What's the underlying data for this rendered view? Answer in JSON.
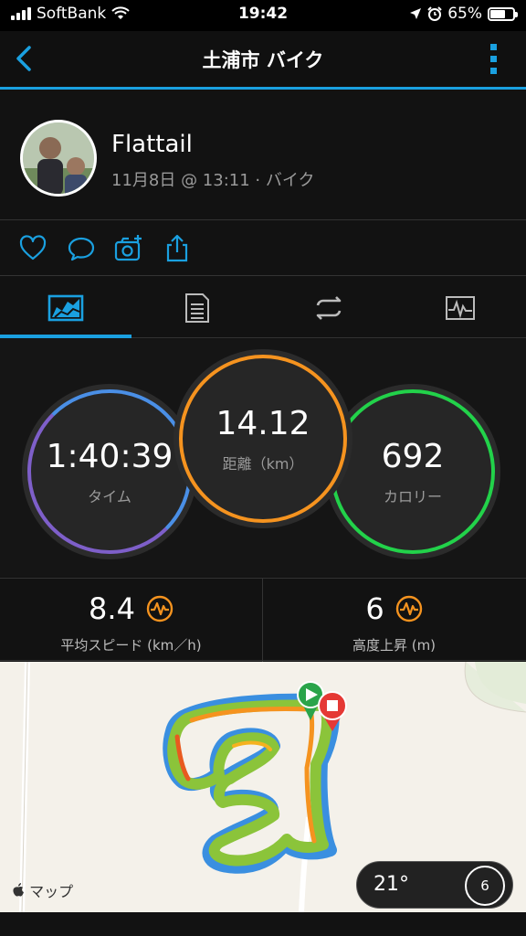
{
  "status_bar": {
    "carrier": "SoftBank",
    "time": "19:42",
    "battery": "65%",
    "battery_level": 0.65
  },
  "header": {
    "title": "土浦市 バイク"
  },
  "profile": {
    "name": "Flattail",
    "meta": "11月8日 @ 13:11 · バイク"
  },
  "stats": {
    "time": {
      "value": "1:40:39",
      "label": "タイム",
      "color": "#4a8fe6"
    },
    "distance": {
      "value": "14.12",
      "label": "距離（km）",
      "color": "#f5931f"
    },
    "calories": {
      "value": "692",
      "label": "カロリー",
      "color": "#22d24a"
    }
  },
  "sub_stats": {
    "avg_speed": {
      "value": "8.4",
      "label": "平均スピード (km／h)"
    },
    "elevation_gain": {
      "value": "6",
      "label": "高度上昇 (m)"
    }
  },
  "map": {
    "attribution": "マップ",
    "temperature": "21°",
    "wind": "6"
  },
  "colors": {
    "accent": "#1aa0e0",
    "icon_orange": "#f5931f"
  }
}
